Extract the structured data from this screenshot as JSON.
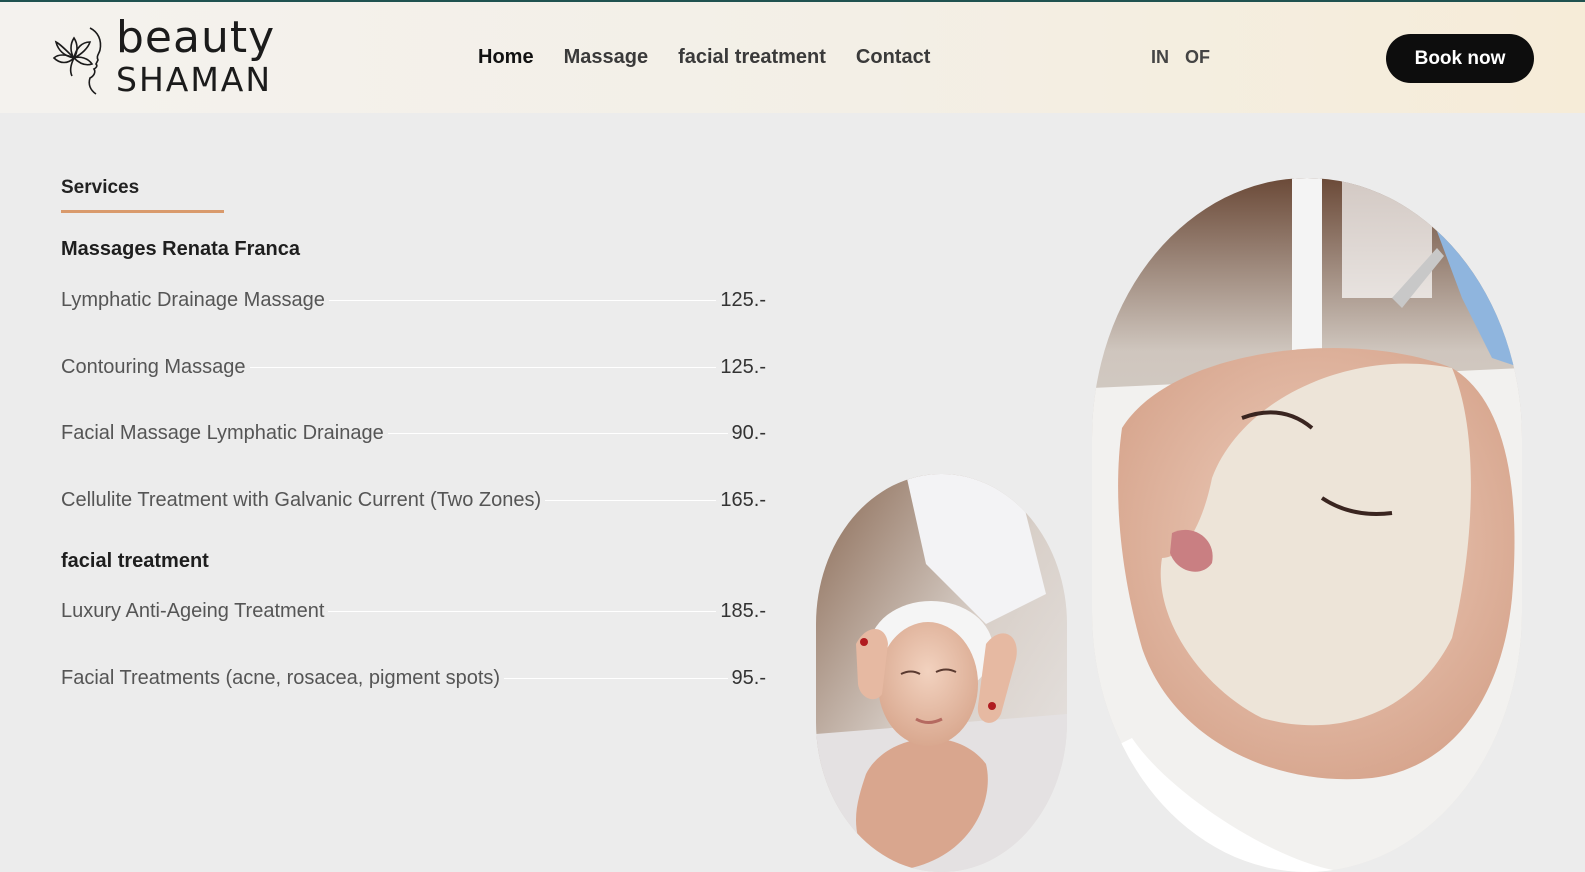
{
  "header": {
    "logo": {
      "line1": "beauty",
      "line2": "SHAMAN"
    },
    "nav": [
      {
        "label": "Home",
        "active": true
      },
      {
        "label": "Massage",
        "active": false
      },
      {
        "label": "facial treatment",
        "active": false
      },
      {
        "label": "Contact",
        "active": false
      }
    ],
    "languages": [
      "IN",
      "OF"
    ],
    "book_label": "Book now"
  },
  "services": {
    "tab_label": "Services",
    "categories": [
      {
        "title": "Massages Renata Franca",
        "items": [
          {
            "name": "Lymphatic Drainage Massage",
            "price": "125.-"
          },
          {
            "name": "Contouring Massage",
            "price": "125.-"
          },
          {
            "name": "Facial Massage Lymphatic Drainage",
            "price": "90.-"
          },
          {
            "name": "Cellulite Treatment with Galvanic Current (Two Zones)",
            "price": "165.-"
          }
        ]
      },
      {
        "title": "facial treatment",
        "items": [
          {
            "name": "Luxury Anti-Ageing Treatment",
            "price": "185.-"
          },
          {
            "name": "Facial Treatments (acne, rosacea, pigment spots)",
            "price": "95.-"
          }
        ]
      }
    ]
  },
  "colors": {
    "accent_underline": "#d99a6c",
    "button_bg": "#0d0d0d",
    "top_border": "#1f5250"
  }
}
